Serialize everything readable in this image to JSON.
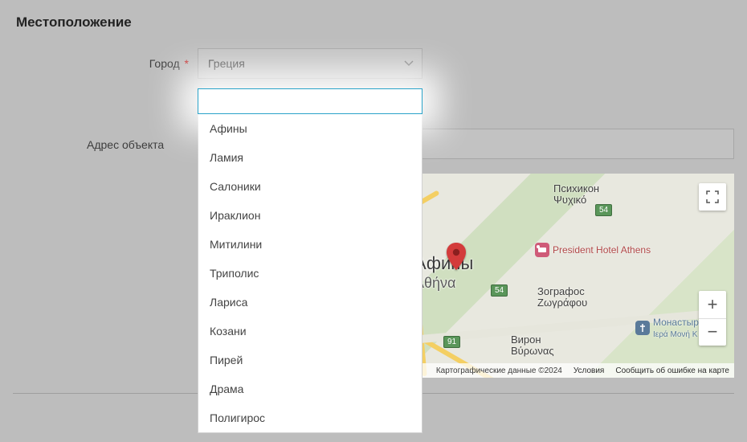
{
  "section_title": "Местоположение",
  "labels": {
    "city": "Город",
    "required_mark": "*",
    "address": "Адрес объекта"
  },
  "city_select": {
    "selected": "Греция"
  },
  "dropdown": {
    "search_value": "",
    "options": [
      "Афины",
      "Ламия",
      "Салоники",
      "Ираклион",
      "Митилини",
      "Триполис",
      "Лариса",
      "Козани",
      "Пирей",
      "Драма",
      "Полигирос"
    ]
  },
  "address_value": "",
  "map": {
    "city_label_ru": "Афины",
    "city_label_gr": "Αθήνα",
    "areas": {
      "psychiko": {
        "ru": "Психикон",
        "gr": "Ψυχικό"
      },
      "zografos": {
        "ru": "Зографос",
        "gr": "Ζωγράφου"
      },
      "vyronas": {
        "ru": "Вирон",
        "gr": "Βύρωνας"
      }
    },
    "poi": {
      "hotel": "President Hotel Athens",
      "monastery": {
        "ru": "Монастырь",
        "gr": "Ιερά Μονή Κ"
      }
    },
    "road_badges": [
      "54",
      "54",
      "91"
    ],
    "footer": {
      "attribution": "Картографические данные ©2024",
      "terms": "Условия",
      "report": "Сообщить об ошибке на карте"
    }
  }
}
